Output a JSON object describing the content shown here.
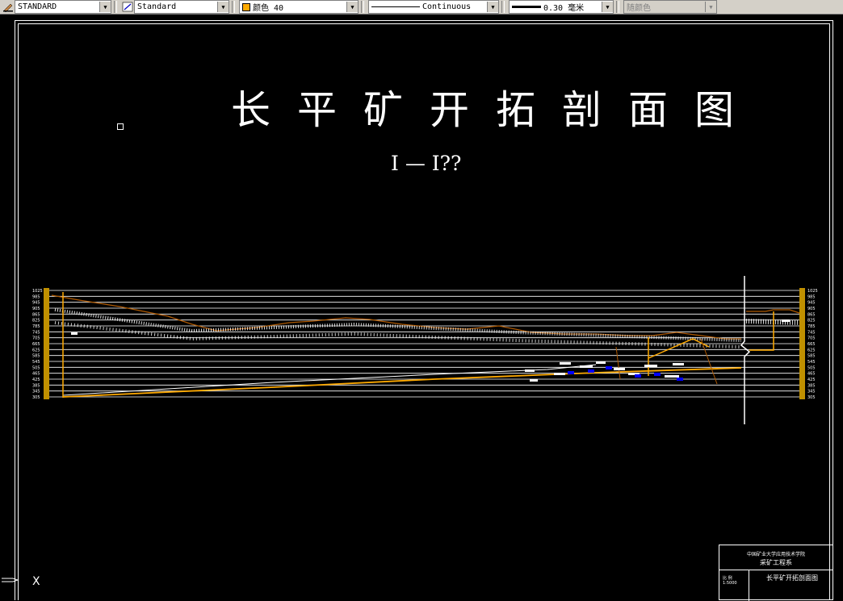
{
  "toolbar": {
    "text_style": "STANDARD",
    "dim_style": "Standard",
    "color": "颜色 40",
    "color_hex": "#ffaa00",
    "linetype": "Continuous",
    "lineweight": "0.30 毫米",
    "plot_style": "随颜色"
  },
  "drawing": {
    "title": "长平矿开拓剖面图",
    "subtitle": "I — I??",
    "left_axis_labels": [
      "1025",
      "985",
      "945",
      "905",
      "865",
      "825",
      "785",
      "745",
      "705",
      "665",
      "625",
      "585",
      "545",
      "505",
      "465",
      "425",
      "385",
      "345",
      "305"
    ],
    "right_axis_labels": [
      "1025",
      "985",
      "945",
      "905",
      "865",
      "825",
      "785",
      "745",
      "705",
      "665",
      "625",
      "585",
      "545",
      "505",
      "465",
      "425",
      "385",
      "345",
      "305"
    ],
    "title_block": {
      "school": "中国矿业大学应用技术学院",
      "department": "采矿工程系",
      "scale_label": "比 例",
      "scale_value": "1:5000",
      "drawing_name": "长平矿开拓剖面图"
    }
  },
  "colors": {
    "background": "#000000",
    "line": "#ffffff",
    "seam": "#ffaa00",
    "roadway": "#0000ff",
    "terrain": "#b05a00"
  }
}
